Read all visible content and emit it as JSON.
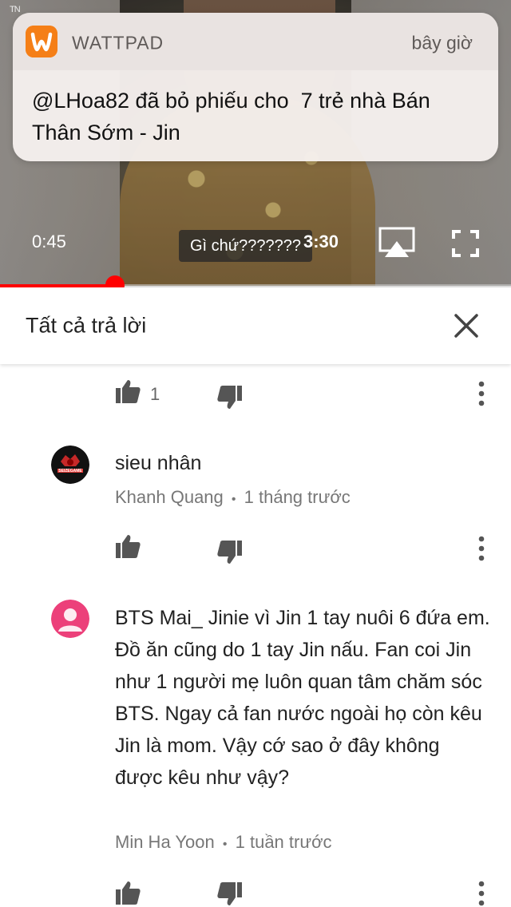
{
  "status": {
    "tn_label": "TN"
  },
  "notification": {
    "app_name": "WATTPAD",
    "time": "bây giờ",
    "message": "@LHoa82 đã bỏ phiếu cho  7 trẻ nhà Bán Thân Sớm - Jin",
    "icon": "wattpad-logo-icon",
    "icon_color": "#f57f17"
  },
  "video": {
    "current_time": "0:45",
    "total_time": "3:30",
    "caption": "Gì chứ???????",
    "progress_fraction": 0.225,
    "progress_color": "#ff0000"
  },
  "header": {
    "title": "Tất cả trả lời",
    "close_icon": "close-icon"
  },
  "comments": [
    {
      "like_count": "1"
    },
    {
      "text": "sieu nhân",
      "author": "Khanh Quang",
      "separator": "•",
      "time": "1 tháng trước",
      "avatar_label": "SEIZEGAME"
    },
    {
      "text": "BTS Mai_ Jinie vì Jin 1 tay nuôi 6 đứa em. Đồ ăn cũng do 1 tay Jin nấu. Fan coi Jin như 1 người mẹ luôn quan tâm chăm sóc BTS. Ngay cả fan nước ngoài họ còn kêu Jin là mom. Vậy cớ sao ở đây không được kêu như vậy?",
      "author": "Min Ha Yoon",
      "separator": "•",
      "time": "1 tuần trước",
      "avatar_color": "#ec407a"
    }
  ]
}
